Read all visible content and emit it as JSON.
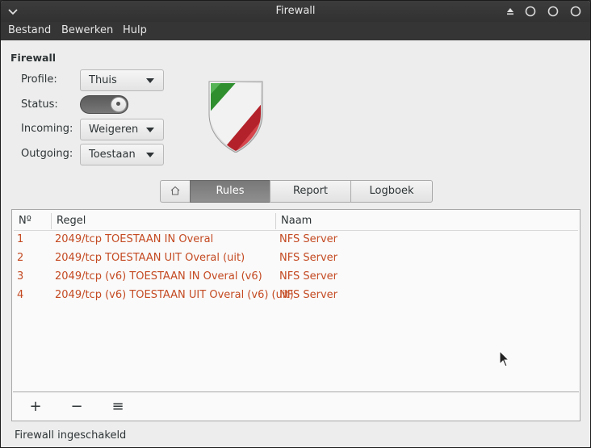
{
  "window": {
    "title": "Firewall"
  },
  "menubar": {
    "items": [
      "Bestand",
      "Bewerken",
      "Hulp"
    ]
  },
  "firewall": {
    "section_title": "Firewall",
    "profile_label": "Profile:",
    "profile_value": "Thuis",
    "status_label": "Status:",
    "status_on": true,
    "incoming_label": "Incoming:",
    "incoming_value": "Weigeren",
    "outgoing_label": "Outgoing:",
    "outgoing_value": "Toestaan"
  },
  "tabs": {
    "home_icon": "home-icon",
    "items": [
      "Rules",
      "Report",
      "Logboek"
    ],
    "active": "Rules"
  },
  "rules": {
    "columns": [
      "Nº",
      "Regel",
      "Naam"
    ],
    "rows": [
      {
        "num": "1",
        "rule": "2049/tcp TOESTAAN IN Overal",
        "name": "NFS Server"
      },
      {
        "num": "2",
        "rule": "2049/tcp TOESTAAN UIT Overal (uit)",
        "name": "NFS Server"
      },
      {
        "num": "3",
        "rule": "2049/tcp (v6) TOESTAAN IN Overal (v6)",
        "name": "NFS Server"
      },
      {
        "num": "4",
        "rule": "2049/tcp (v6) TOESTAAN UIT Overal (v6) (uit)",
        "name": "NFS Server"
      }
    ],
    "row_color": "#c44a22"
  },
  "list_toolbar": {
    "add": "+",
    "remove": "−",
    "menu": "≡"
  },
  "status": {
    "text": "Firewall ingeschakeld"
  }
}
